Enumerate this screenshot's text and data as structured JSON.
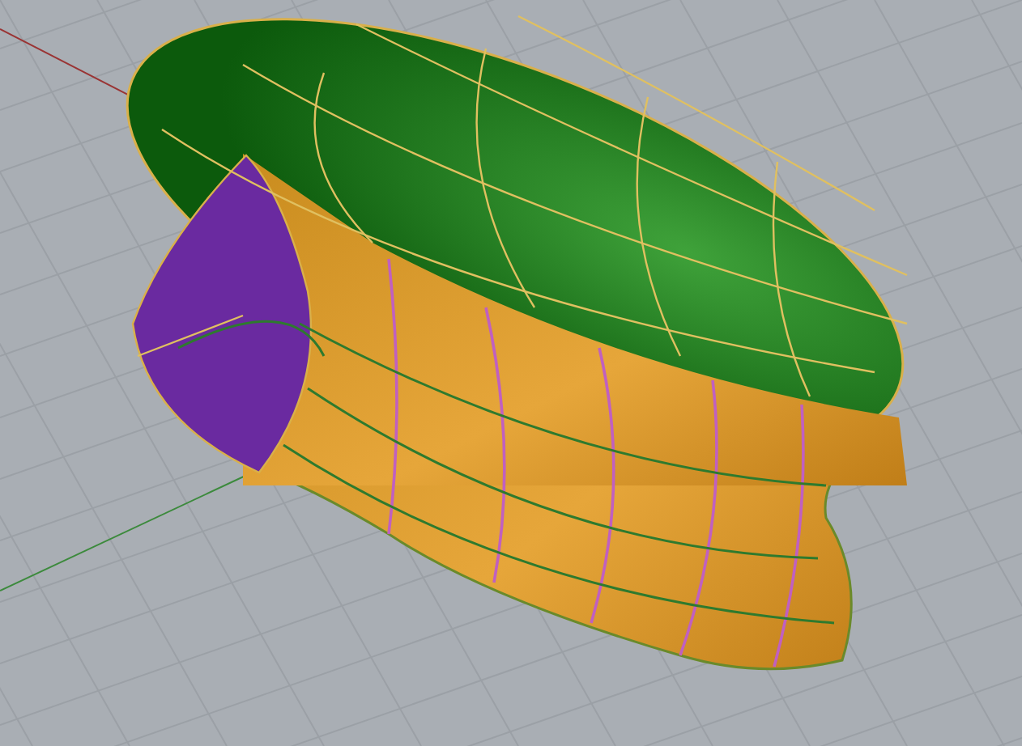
{
  "viewport": {
    "grid": true,
    "axes": true
  }
}
